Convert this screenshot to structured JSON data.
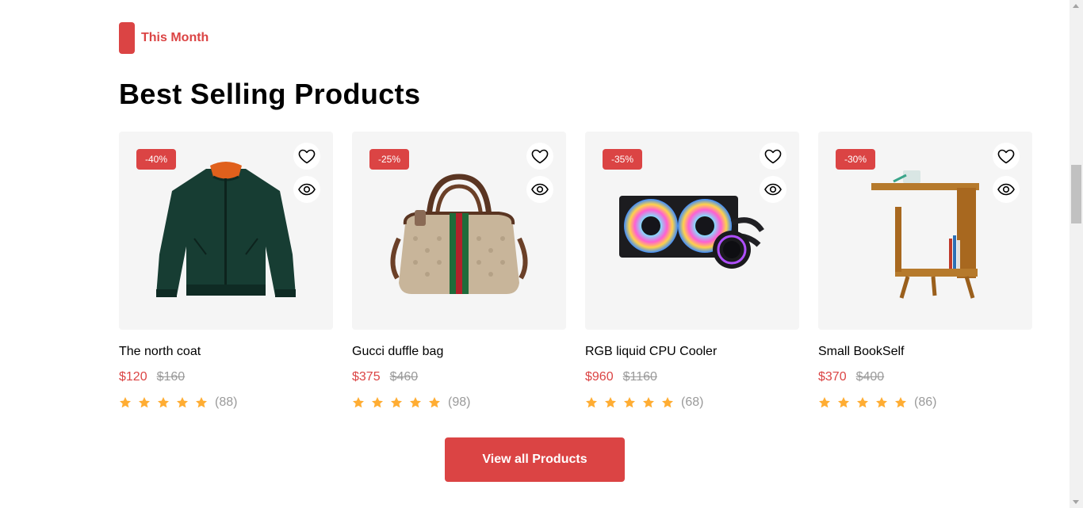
{
  "section": {
    "tag": "This Month",
    "title": "Best Selling Products"
  },
  "colors": {
    "accent": "#DB4444",
    "card_bg": "#F5F5F5",
    "star": "#FFAD33",
    "muted": "#9a9a9a"
  },
  "products": [
    {
      "name": "The north coat",
      "discount": "-40%",
      "price": "$120",
      "old_price": "$160",
      "rating": 5,
      "reviews": "(88)",
      "icon": "green-bomber-jacket-image"
    },
    {
      "name": "Gucci duffle bag",
      "discount": "-25%",
      "price": "$375",
      "old_price": "$460",
      "rating": 5,
      "reviews": "(98)",
      "icon": "duffle-bag-image"
    },
    {
      "name": "RGB liquid CPU Cooler",
      "discount": "-35%",
      "price": "$960",
      "old_price": "$1160",
      "rating": 5,
      "reviews": "(68)",
      "icon": "cpu-cooler-image"
    },
    {
      "name": "Small BookSelf",
      "discount": "-30%",
      "price": "$370",
      "old_price": "$400",
      "rating": 5,
      "reviews": "(86)",
      "icon": "bookshelf-image"
    }
  ],
  "cta": {
    "label": "View all Products"
  }
}
